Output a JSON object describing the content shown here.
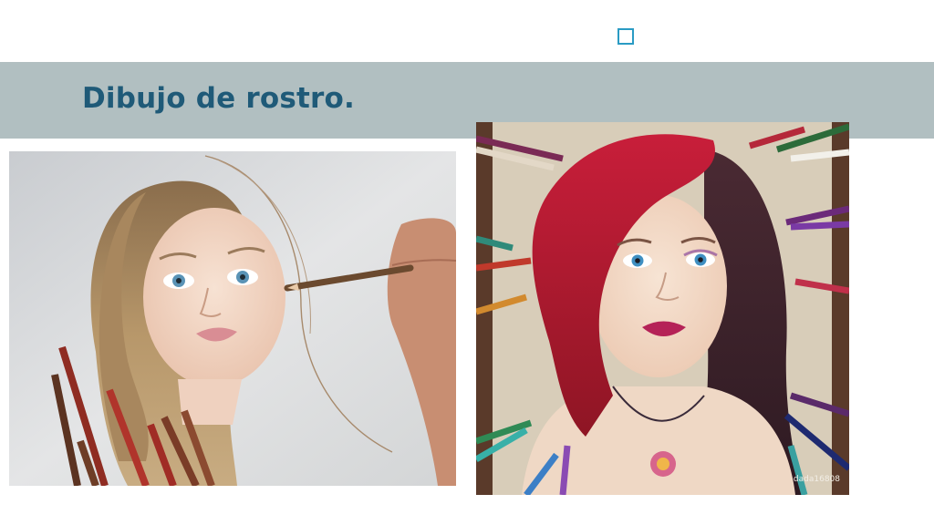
{
  "slide": {
    "title": "Dibujo de rostro."
  },
  "images": {
    "left": {
      "icon": "portrait-drawing-blonde-girl-colored-pencils"
    },
    "right": {
      "icon": "portrait-drawing-red-dark-hair-colored-pencils",
      "watermark": "dada16808"
    }
  },
  "colors": {
    "title_text": "#1f5a78",
    "title_band": "#b1bfc1",
    "accent_square": "#2a9bc4"
  }
}
